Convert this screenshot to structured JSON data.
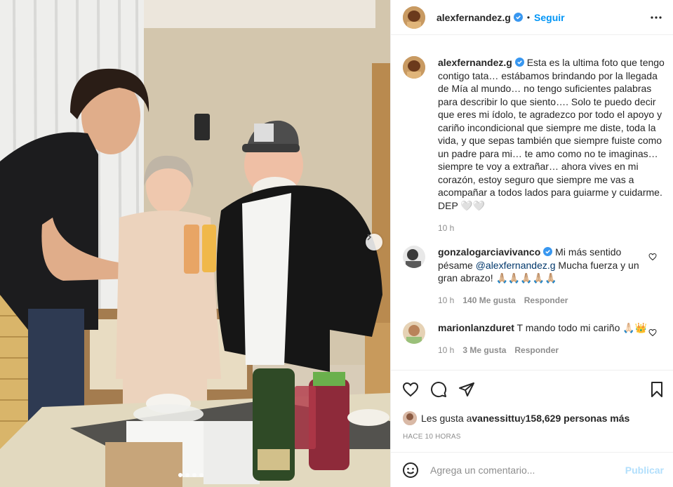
{
  "post": {
    "username": "alexfernandez.g",
    "follow_label": "Seguir",
    "separator": "•",
    "caption": "Esta es la ultima foto que tengo contigo tata… estábamos brindando por la llegada de Mía al mundo… no tengo suficientes palabras para describir lo que siento…. Solo te puedo decir que eres mi ídolo, te agradezco por todo el apoyo y cariño incondicional que siempre me diste, toda la vida, y que sepas también que siempre fuiste como un padre para mi… te amo como no te imaginas… siempre te voy a extrañar… ahora vives en mi corazón, estoy seguro que siempre me vas a acompañar a todos lados para guiarme y cuidarme. DEP 🤍🤍",
    "caption_time": "10 h"
  },
  "comments": [
    {
      "username": "gonzalogarciavivanco",
      "verified": true,
      "text_before": "Mi más sentido pésame ",
      "mention": "@alexfernandez.g",
      "text_after": " Mucha fuerza y un gran abrazo! 🙏🏼🙏🏼🙏🏼🙏🏼🙏🏼",
      "time": "10 h",
      "likes": "140 Me gusta",
      "reply_label": "Responder"
    },
    {
      "username": "marionlanzduret",
      "verified": false,
      "text": "T mando todo mi cariño 🙏🏻👑",
      "time": "10 h",
      "likes": "3 Me gusta",
      "reply_label": "Responder"
    }
  ],
  "likes_line": {
    "prefix": "Les gusta a ",
    "user": "vanessittu",
    "middle": " y ",
    "count": "158,629 personas más"
  },
  "time_ago": "HACE 10 HORAS",
  "comment_box": {
    "placeholder": "Agrega un comentario...",
    "publish_label": "Publicar"
  },
  "carousel": {
    "slide_count": 4,
    "active_index": 0
  },
  "colors": {
    "accent": "#0095f6",
    "verified": "#3897f0",
    "publish_disabled": "#b2dffc",
    "muted": "#8e8e8e"
  }
}
